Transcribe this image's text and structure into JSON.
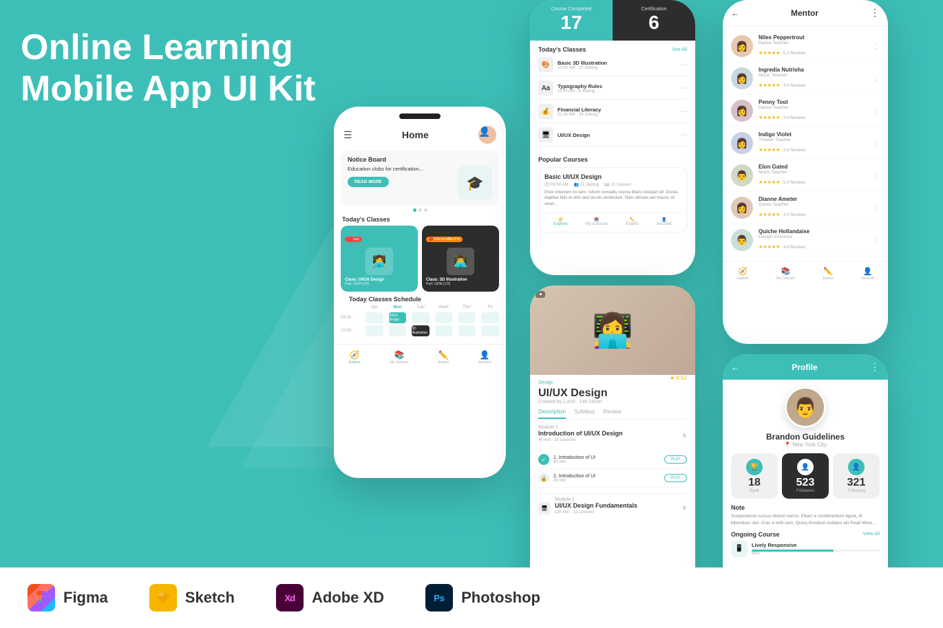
{
  "app": {
    "title_line1": "Online Learning",
    "title_line2": "Mobile App UI Kit"
  },
  "tools": [
    {
      "name": "Figma",
      "icon_type": "figma",
      "label": "Figma"
    },
    {
      "name": "Sketch",
      "icon_type": "sketch",
      "label": "Sketch"
    },
    {
      "name": "AdobeXD",
      "icon_type": "xd",
      "label": "Adobe XD"
    },
    {
      "name": "Photoshop",
      "icon_type": "ps",
      "label": "Photoshop"
    }
  ],
  "phone_home": {
    "header_title": "Home",
    "notice_label": "Notice Board",
    "notice_text": "Education clubs for certification...",
    "read_more": "READ MORE",
    "today_classes": "Today's Classes",
    "class1_badge": "🔴 Live",
    "class1_name": "Class: UI/UX Design",
    "class1_part": "Part: GDM (2/4)",
    "class2_badge": "🔴 Live on after 2 hr",
    "class2_name": "Class: 3D Illustration",
    "class2_part": "Part: GDM (1/3)",
    "schedule_title": "Today Classes Schedule",
    "days": [
      "Apr",
      "Mon",
      "Tue*",
      "Wed*",
      "Thu*",
      "Fri"
    ],
    "time1": "09:00",
    "slot1": "UI/UX Design",
    "time2": "10:00",
    "slot2": "3D Illustration",
    "nav_items": [
      "Explore",
      "My Courses",
      "Exams",
      "Account"
    ]
  },
  "phone_dashboard": {
    "stat1_label": "Course Completed",
    "stat1_num": "17",
    "stat2_label": "Certification",
    "stat2_num": "6",
    "classes_title": "Today's Classes",
    "see_all": "See All",
    "classes": [
      {
        "name": "Basic 3D Illustration",
        "meta": "10:00 AM · 12 Joining"
      },
      {
        "name": "Typography Rules",
        "meta": "11:00 AM · 8 Joining"
      },
      {
        "name": "Financial Literacy",
        "meta": "01:30 PM · 24 Joining"
      },
      {
        "name": "UI/UX Design",
        "meta": ""
      }
    ],
    "popular_title": "Popular Courses",
    "popular_course_name": "Basic UI/UX Design",
    "popular_meta1": "09:00 AM",
    "popular_meta2": "12 Joining",
    "popular_meta3": "15 Classes",
    "popular_desc": "Proin interdum mi sem, rutrum convallis course libero volutpat vel. Donec dapibus felis et nibh and iaculis vestibulum. Nam ultricies eet mauris sit amet...",
    "nav_items": [
      "Explore",
      "My Courses",
      "Exams",
      "Account"
    ]
  },
  "phone_course": {
    "category": "Design",
    "title": "UI/UX Design",
    "subtitle": "Created by Lurch · 14h 15min",
    "rating": "★ 4.51",
    "tabs": [
      "Description",
      "Syllabus",
      "Review"
    ],
    "active_tab": "Description",
    "module1_num": "Module 1",
    "module1_title": "Introduction of UI/UX Design",
    "module1_meta": "45 min · 15 Lessons",
    "lessons": [
      {
        "name": "1. Introduction of UI",
        "dur": "60 min"
      },
      {
        "name": "2. Introduction of UI",
        "dur": "45 min"
      }
    ],
    "module2_num": "Module 2",
    "module2_title": "UI/UX Design Fundamentals",
    "module2_meta": "120 min · 13 Lessons"
  },
  "phone_mentor": {
    "title": "Mentor",
    "mentors": [
      {
        "name": "Niles Peppertrout",
        "role": "Dance Teacher",
        "stars": "★★★★★",
        "reviews": "5.0 Reviews"
      },
      {
        "name": "Ingredia Nutrisha",
        "role": "Music Teacher",
        "stars": "★★★★★",
        "reviews": "4.6 Reviews"
      },
      {
        "name": "Penny Tool",
        "role": "Dance Teacher",
        "stars": "★★★★★",
        "reviews": "4.9 Reviews"
      },
      {
        "name": "Indigo Violet",
        "role": "Theater Teacher",
        "stars": "★★★★★",
        "reviews": "4.8 Reviews"
      },
      {
        "name": "Elon Gated",
        "role": "Music Teacher",
        "stars": "★★★★★",
        "reviews": "5.0 Reviews"
      },
      {
        "name": "Dianne Ameter",
        "role": "Dance Teacher",
        "stars": "★★★★★",
        "reviews": "4.5 Reviews"
      },
      {
        "name": "Quiche Hollandaise",
        "role": "Design Instructor",
        "stars": "★★★★★",
        "reviews": "4.6 Reviews"
      }
    ],
    "nav_items": [
      "Explore",
      "My Courses",
      "Exams",
      "Account"
    ]
  },
  "phone_profile": {
    "title": "Profile",
    "name": "Brandon Guidelines",
    "location": "New York City",
    "stats": [
      {
        "label": "Rank",
        "value": "18",
        "icon": "🏆"
      },
      {
        "label": "Followers",
        "value": "523",
        "icon": "👤"
      },
      {
        "label": "Following",
        "value": "321",
        "icon": "👤"
      }
    ],
    "note_title": "Note",
    "note_text": "Suspendisse cursus dictum varius. Etiam a condimentum ligula, id bibendum nisl. Cras a velit sem. Quisq tincidunt sodales elit Read More...",
    "ongoing_title": "Ongoing Course",
    "view_all": "View All",
    "ongoing_course": "Lively Responsive",
    "ongoing_pct": "64%"
  }
}
